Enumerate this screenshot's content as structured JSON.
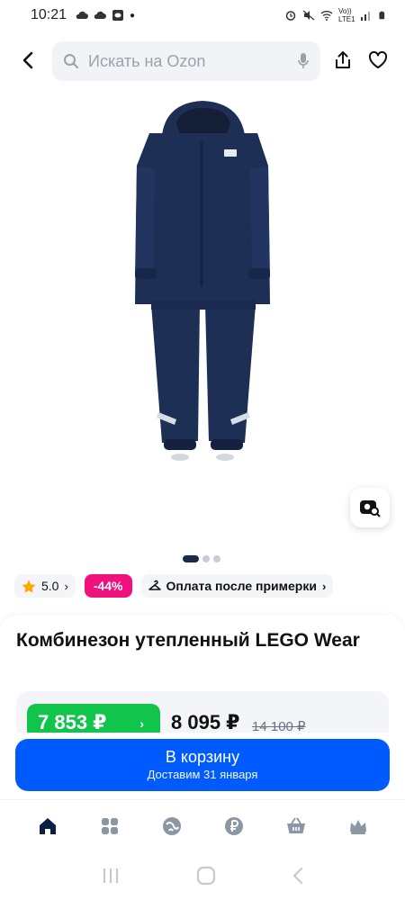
{
  "status_bar": {
    "time": "10:21",
    "network": "Vo)) LTE1"
  },
  "search": {
    "placeholder": "Искать на Ozon"
  },
  "gallery": {
    "image_count": 3,
    "active_index": 0
  },
  "badges": {
    "rating": "5.0",
    "discount": "-44%",
    "payment": "Оплата после примерки"
  },
  "product": {
    "title": "Комбинезон утепленный LEGO Wear",
    "price_card": "7 853 ₽",
    "price": "8 095 ₽",
    "price_old": "14 100 ₽"
  },
  "cart_button": {
    "label": "В корзину",
    "delivery": "Доставим 31 января"
  },
  "bottom_nav": {
    "items": [
      "home-icon",
      "catalog-icon",
      "fresh-icon",
      "points-icon",
      "cart-icon",
      "profile-icon"
    ]
  },
  "colors": {
    "accent": "#005bff",
    "discount": "#f1117e",
    "price_green": "#10c44c",
    "suit": "#1e2f55"
  }
}
